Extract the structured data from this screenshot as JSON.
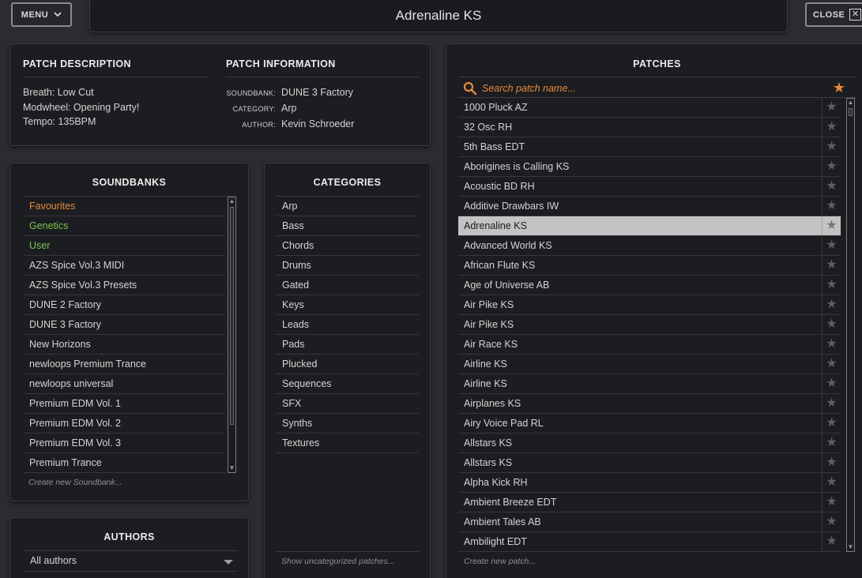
{
  "header": {
    "menu_label": "MENU",
    "title": "Adrenaline KS",
    "close_label": "CLOSE"
  },
  "description": {
    "title": "PATCH DESCRIPTION",
    "lines": [
      "Breath: Low Cut",
      "Modwheel: Opening Party!",
      "Tempo: 135BPM"
    ]
  },
  "information": {
    "title": "PATCH INFORMATION",
    "soundbank_key": "SOUNDBANK:",
    "soundbank": "DUNE 3 Factory",
    "category_key": "CATEGORY:",
    "category": "Arp",
    "author_key": "AUTHOR:",
    "author": "Kevin Schroeder"
  },
  "soundbanks": {
    "title": "SOUNDBANKS",
    "items": [
      "Favourites",
      "Genetics",
      "User",
      "AZS Spice Vol.3 MIDI",
      "AZS Spice Vol.3 Presets",
      "DUNE 2 Factory",
      "DUNE 3 Factory",
      "New Horizons",
      "newloops Premium Trance",
      "newloops universal",
      "Premium EDM Vol. 1",
      "Premium EDM Vol. 2",
      "Premium EDM Vol. 3",
      "Premium Trance"
    ],
    "create_hint": "Create new Soundbank..."
  },
  "authors": {
    "title": "AUTHORS",
    "selected": "All authors"
  },
  "categories": {
    "title": "CATEGORIES",
    "items": [
      "Arp",
      "Bass",
      "Chords",
      "Drums",
      "Gated",
      "Keys",
      "Leads",
      "Pads",
      "Plucked",
      "Sequences",
      "SFX",
      "Synths",
      "Textures"
    ],
    "hint": "Show uncategorized patches..."
  },
  "patches": {
    "title": "PATCHES",
    "search_placeholder": "Search patch name...",
    "items": [
      "1000 Pluck AZ",
      "32 Osc RH",
      "5th Bass EDT",
      "Aborigines is Calling KS",
      "Acoustic BD RH",
      "Additive Drawbars IW",
      "Adrenaline KS",
      "Advanced World KS",
      "African Flute KS",
      "Age of Universe AB",
      "Air Pike KS",
      "Air Pike KS",
      "Air Race KS",
      "Airline KS",
      "Airline KS",
      "Airplanes KS",
      "Airy Voice Pad RL",
      "Allstars KS",
      "Allstars KS",
      "Alpha Kick RH",
      "Ambient Breeze EDT",
      "Ambient Tales AB",
      "Ambilight EDT"
    ],
    "selected_index": 6,
    "create_hint": "Create new patch..."
  },
  "colors": {
    "accent_orange": "#e58a3d",
    "green": "#7bc24e",
    "selected_row": "#c3c3c3"
  }
}
